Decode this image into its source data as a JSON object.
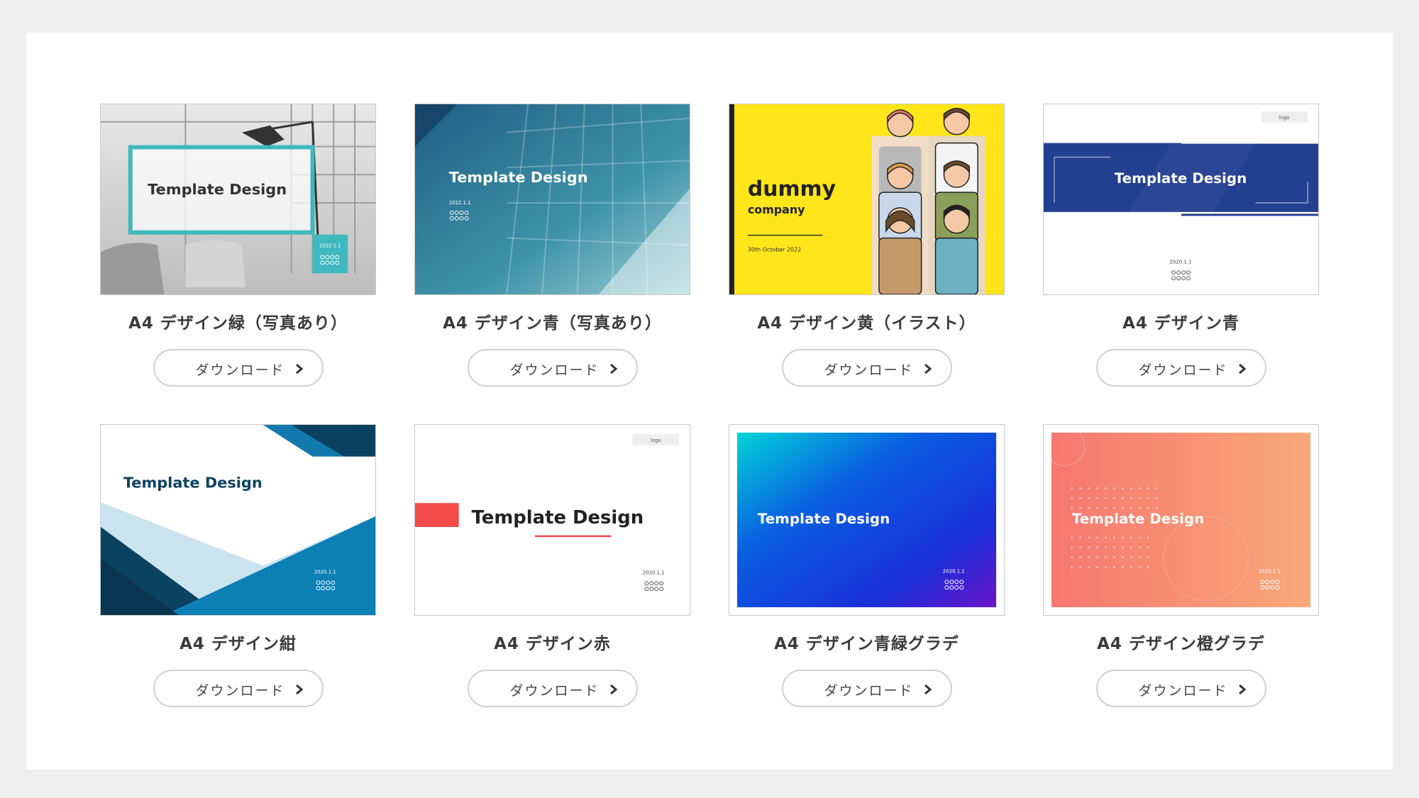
{
  "download_label": "ダウンロード",
  "cards": [
    {
      "title": "A4 デザイン緑（写真あり）",
      "thumb_heading": "Template Design",
      "thumb_date": "2022.1.1",
      "thumb_org": "○○○○\n○○○○",
      "accent": "#3fb8bf"
    },
    {
      "title": "A4 デザイン青（写真あり）",
      "thumb_heading": "Template Design",
      "thumb_date": "2022.1.1",
      "thumb_org": "○○○○\n○○○○",
      "accent": "#2a7f9c"
    },
    {
      "title": "A4 デザイン黄（イラスト）",
      "thumb_heading": "dummy",
      "thumb_subheading": "company",
      "thumb_date": "30th October 2022",
      "accent": "#ffe51a"
    },
    {
      "title": "A4 デザイン青",
      "thumb_heading": "Template Design",
      "thumb_logo": "logo",
      "thumb_date": "2020.1.1",
      "thumb_org": "○○○○\n○○○○",
      "accent": "#233f90"
    },
    {
      "title": "A4 デザイン紺",
      "thumb_heading": "Template Design",
      "thumb_date": "2020.1.1",
      "thumb_org": "○○○○\n○○○○",
      "accent": "#0b4260"
    },
    {
      "title": "A4 デザイン赤",
      "thumb_heading": "Template Design",
      "thumb_logo": "logo",
      "thumb_date": "2020.1.1",
      "thumb_org": "○○○○\n○○○○",
      "accent": "#f44b4b"
    },
    {
      "title": "A4 デザイン青緑グラデ",
      "thumb_heading": "Template Design",
      "thumb_date": "2020.1.1",
      "thumb_org": "○○○○\n○○○○",
      "accent": "#1336e0"
    },
    {
      "title": "A4 デザイン橙グラデ",
      "thumb_heading": "Template Design",
      "thumb_date": "2020.1.1",
      "thumb_org": "○○○○\n○○○○",
      "accent": "#f6826a"
    }
  ]
}
